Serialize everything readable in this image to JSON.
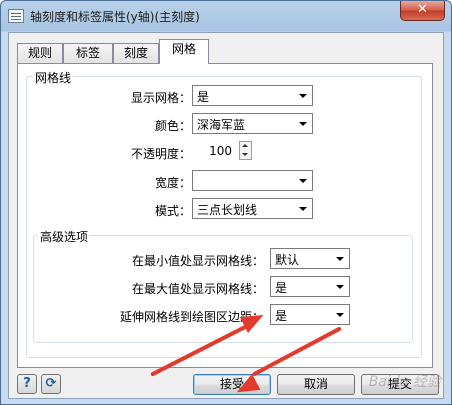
{
  "window": {
    "title": "轴刻度和标签属性(y轴)(主刻度)",
    "close_label": "✕"
  },
  "tabs": [
    {
      "label": "规则",
      "active": false
    },
    {
      "label": "标签",
      "active": false
    },
    {
      "label": "刻度",
      "active": false
    },
    {
      "label": "网格",
      "active": true
    }
  ],
  "grid_group": {
    "title": "网格线",
    "show_grid": {
      "label": "显示网格：",
      "value": "是"
    },
    "color": {
      "label": "颜色：",
      "value": "深海军蓝"
    },
    "opacity": {
      "label": "不透明度：",
      "value": "100"
    },
    "width": {
      "label": "宽度：",
      "value": ""
    },
    "style": {
      "label": "模式：",
      "value": "三点长划线"
    }
  },
  "advanced_group": {
    "title": "高级选项",
    "show_at_min": {
      "label": "在最小值处显示网格线：",
      "value": "默认"
    },
    "show_at_max": {
      "label": "在最大值处显示网格线：",
      "value": "是"
    },
    "extend_to_edge": {
      "label": "延伸网格线到绘图区边距：",
      "value": "是"
    }
  },
  "footer": {
    "help_icon": "?",
    "refresh_icon": "⟳",
    "ok_label": "接受",
    "cancel_label": "取消",
    "apply_label": "提交"
  },
  "watermark": "Baidu 经验",
  "colors": {
    "annotation_arrow": "#e23a2d",
    "title_bar": "#b9d1ea",
    "close_button": "#c13b25"
  }
}
